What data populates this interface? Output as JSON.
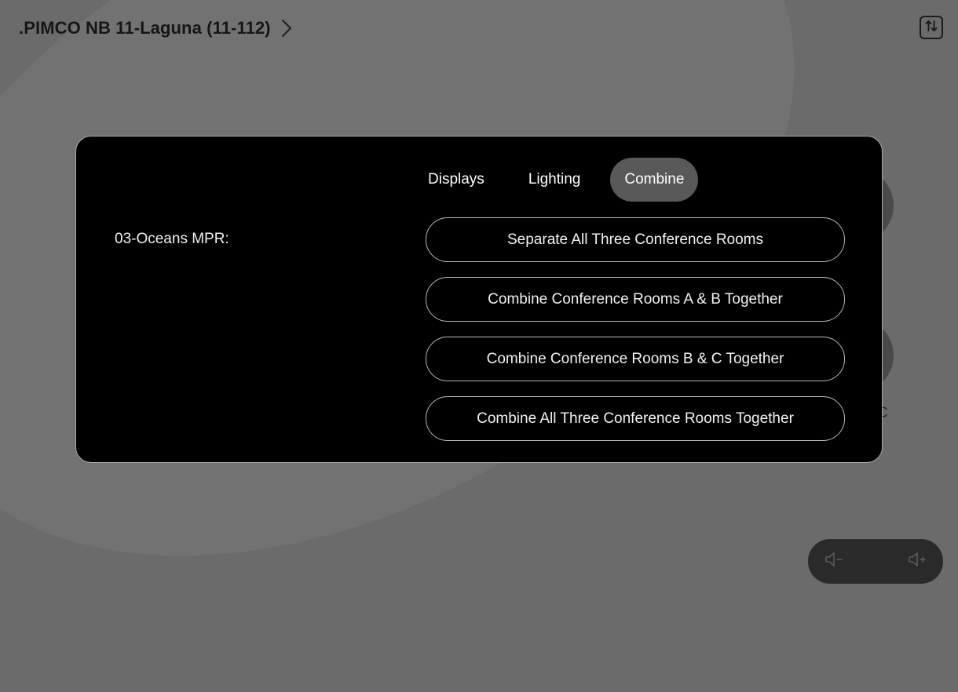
{
  "header": {
    "title": ".PIMCO NB 11-Laguna (11-112)",
    "chevron_icon": "chevron-right-icon"
  },
  "top_right": {
    "icon": "sort-arrows-icon"
  },
  "modal": {
    "tabs": [
      {
        "label": "Displays",
        "active": false
      },
      {
        "label": "Lighting",
        "active": false
      },
      {
        "label": "Combine",
        "active": true
      }
    ],
    "room_label": "03-Oceans MPR:",
    "options": [
      {
        "label": "Separate All Three Conference Rooms"
      },
      {
        "label": "Combine Conference Rooms A & B Together"
      },
      {
        "label": "Combine Conference Rooms B & C Together"
      },
      {
        "label": "Combine All Three Conference Rooms Together"
      }
    ]
  },
  "background": {
    "partial_letter": "C"
  },
  "volume": {
    "down_icon": "volume-down-icon",
    "up_icon": "volume-up-icon"
  },
  "colors": {
    "background": "#6b6b6b",
    "modal": "#000000",
    "active_tab": "#595959",
    "volume_bar": "#2a2a2a"
  }
}
